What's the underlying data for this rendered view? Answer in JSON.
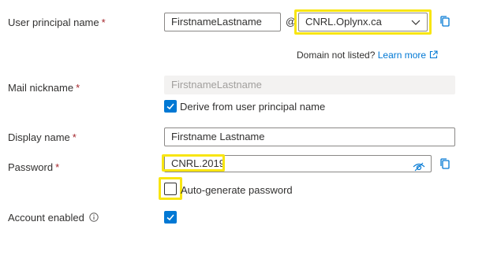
{
  "upn": {
    "label": "User principal name",
    "required_marker": "*",
    "value": "FirstnameLastname",
    "at_symbol": "@",
    "domain_value": "CNRL.Oplynx.ca",
    "domain_help_text": "Domain not listed?",
    "learn_more_label": "Learn more"
  },
  "mail_nickname": {
    "label": "Mail nickname",
    "required_marker": "*",
    "value": "FirstnameLastname",
    "derive_label": "Derive from user principal name",
    "derive_checked": true
  },
  "display_name": {
    "label": "Display name",
    "required_marker": "*",
    "value": "Firstname Lastname"
  },
  "password": {
    "label": "Password",
    "required_marker": "*",
    "value": "CNRL.2019",
    "autogen_label": "Auto-generate password",
    "autogen_checked": false
  },
  "account_enabled": {
    "label": "Account enabled",
    "checked": true
  },
  "icons": {
    "copy": "copy-icon",
    "chevron": "chevron-down-icon",
    "external_link": "external-link-icon",
    "eye": "reveal-password-icon",
    "info": "info-icon"
  },
  "colors": {
    "accent": "#0078d4",
    "required": "#a4262c",
    "highlight": "#f8e512",
    "disabled_bg": "#f3f2f1"
  }
}
